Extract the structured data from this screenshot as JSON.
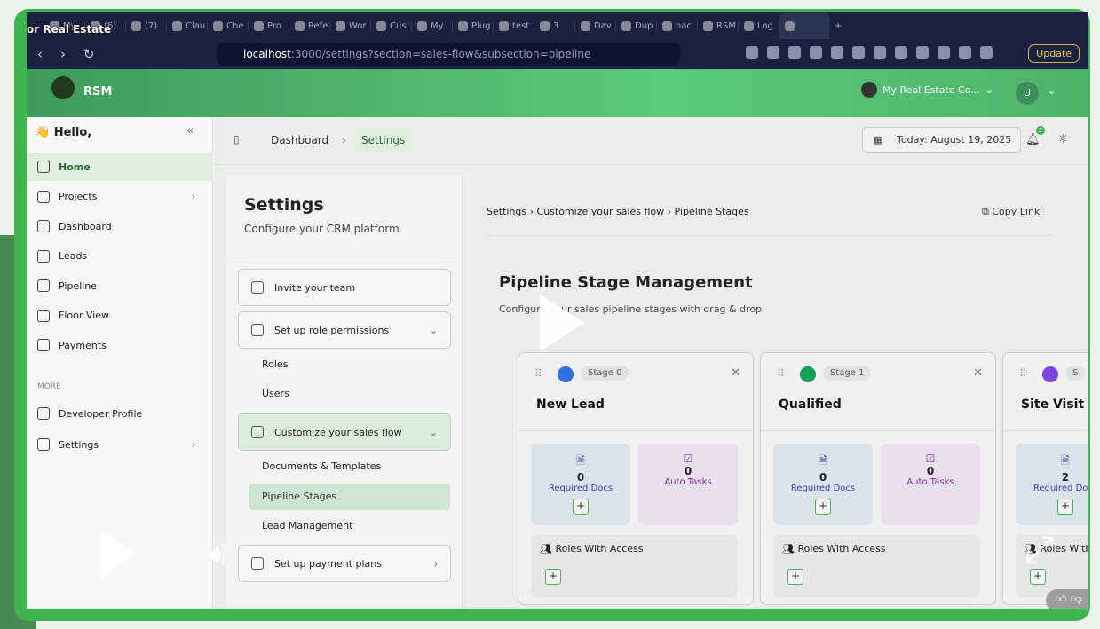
{
  "video": {
    "title": "or Real Estate"
  },
  "browser": {
    "tabs": [
      "My",
      "(6)",
      "(7)",
      "Clau",
      "Che",
      "Pro",
      "Refe",
      "Wor",
      "Cus",
      "My",
      "Plug",
      "test",
      "3",
      "Dav",
      "Dup",
      "hac",
      "RSM",
      "Log",
      ""
    ],
    "url_host": "localhost",
    "url_rest": ":3000/settings?section=sales-flow&subsection=pipeline",
    "update_label": "Update"
  },
  "header": {
    "brand": "RSM",
    "org": "My Real Estate Co...",
    "avatar": "U"
  },
  "sidebar": {
    "greeting": "👋 Hello,",
    "items": [
      {
        "label": "Home",
        "active": true
      },
      {
        "label": "Projects",
        "arrow": true
      },
      {
        "label": "Dashboard"
      },
      {
        "label": "Leads"
      },
      {
        "label": "Pipeline"
      },
      {
        "label": "Floor View"
      },
      {
        "label": "Payments"
      }
    ],
    "more_label": "MORE",
    "more_items": [
      {
        "label": "Developer Profile"
      },
      {
        "label": "Settings",
        "arrow": true
      }
    ]
  },
  "topbar": {
    "crumbs": [
      "Dashboard",
      "Settings"
    ],
    "today": "Today: August 19, 2025",
    "notif_count": "2"
  },
  "settings": {
    "title": "Settings",
    "subtitle": "Configure your CRM platform",
    "cards": [
      "Invite your team",
      "Set up role permissions",
      "Customize your sales flow",
      "Set up payment plans"
    ],
    "role_sub": [
      "Roles",
      "Users"
    ],
    "flow_sub": [
      "Documents & Templates",
      "Pipeline Stages",
      "Lead Management"
    ]
  },
  "content": {
    "breadcrumb": "Settings  ›  Customize your sales flow  ›  Pipeline Stages",
    "copy_link": "Copy Link",
    "title": "Pipeline Stage Management",
    "desc": "Configure your sales pipeline stages with drag & drop",
    "stages": [
      {
        "badge": "Stage 0",
        "name": "New Lead",
        "color": "#2f6fe0",
        "docs": "0",
        "tasks": "0"
      },
      {
        "badge": "Stage 1",
        "name": "Qualified",
        "color": "#12a05a",
        "docs": "0",
        "tasks": "0"
      },
      {
        "badge": "S",
        "name": "Site Visit",
        "color": "#7b45e0",
        "docs": "2",
        "tasks": ""
      }
    ],
    "docs_label": "Required Docs",
    "tasks_label": "Auto Tasks",
    "roles_label": "Roles With Access"
  },
  "colors": {
    "frame": "#3fb54f",
    "accent": "#2a6a3a",
    "tabbar": "#1b2140"
  }
}
